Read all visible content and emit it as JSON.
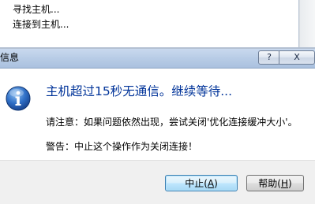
{
  "background_window": {
    "list_items": [
      "寻找主机...",
      "连接到主机..."
    ]
  },
  "dialog": {
    "title": "信息",
    "titlebar_buttons": {
      "help_label": "?",
      "close_label": "X"
    },
    "icon": "information-icon",
    "main_instruction": "主机超过15秒无通信。继续等待...",
    "note": "请注意：如果问题依然出现，尝试关闭'优化连接缓冲大小'。",
    "warning": "警告：中止这个操作作为关闭连接！",
    "buttons": {
      "abort": {
        "text": "中止(",
        "mnemonic": "A",
        "suffix": ")"
      },
      "help": {
        "text": "帮助(",
        "mnemonic": "H",
        "suffix": ")"
      }
    }
  },
  "colors": {
    "instruction_text": "#003399",
    "titlebar": "#b8cce6",
    "icon_blue": "#1f5fb8"
  }
}
